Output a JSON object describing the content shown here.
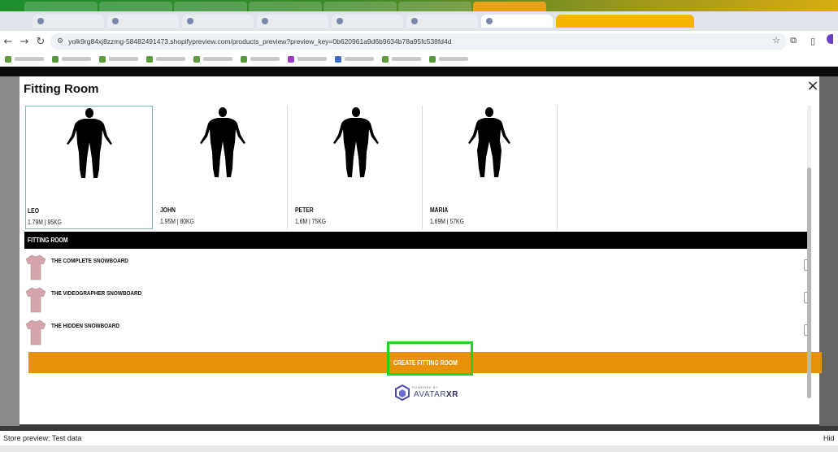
{
  "browser": {
    "url": "yolk9rg84xj8zzmg-58482491473.shopifypreview.com/products_preview?preview_key=0b620961a9d6b9634b78a95fc538fd4d"
  },
  "modal": {
    "title": "Fitting Room",
    "close_icon": "×"
  },
  "avatars": [
    {
      "name": "LEO",
      "stats": "1.79M | 95KG",
      "selected": true
    },
    {
      "name": "JOHN",
      "stats": "1.95M | 80KG",
      "selected": false
    },
    {
      "name": "PETER",
      "stats": "1.6M | 75KG",
      "selected": false
    },
    {
      "name": "MARIA",
      "stats": "1.69M | 57KG",
      "selected": false
    }
  ],
  "section": {
    "title": "FITTING ROOM",
    "chevron": "⌄"
  },
  "products": [
    {
      "name": "THE COMPLETE SNOWBOARD"
    },
    {
      "name": "THE VIDEOGRAPHER SNOWBOARD"
    },
    {
      "name": "THE HIDDEN SNOWBOARD"
    }
  ],
  "create_button": {
    "label": "CREATE FITTING ROOM"
  },
  "powered_by": {
    "small": "POWERED BY",
    "brand_a": "AVATAR",
    "brand_b": "XR"
  },
  "statusbar": {
    "left": "Store preview: Test data",
    "right": "Hide"
  },
  "colors": {
    "accent": "#e8920a",
    "highlight": "#22d422",
    "section_bar": "#000000",
    "tshirt": "#d4a5ad"
  }
}
